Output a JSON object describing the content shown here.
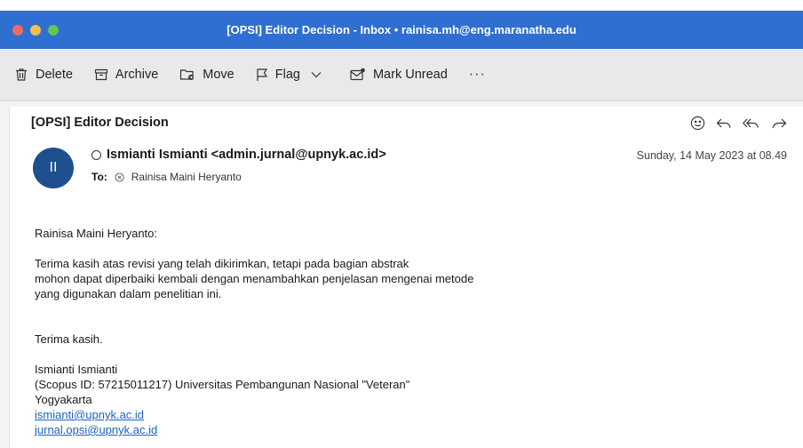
{
  "window": {
    "title": "[OPSI] Editor Decision - Inbox • rainisa.mh@eng.maranatha.edu",
    "traffic_colors": {
      "close": "#ed6a5e",
      "minimize": "#f5bf4f",
      "maximize": "#62c554"
    }
  },
  "toolbar": {
    "delete_label": "Delete",
    "archive_label": "Archive",
    "move_label": "Move",
    "flag_label": "Flag",
    "mark_unread_label": "Mark Unread",
    "more_label": "···"
  },
  "message": {
    "subject": "[OPSI] Editor Decision",
    "avatar_initials": "II",
    "from": "Ismianti Ismianti <admin.jurnal@upnyk.ac.id>",
    "to_label": "To:",
    "to": "Rainisa Maini Heryanto",
    "date": "Sunday, 14 May 2023 at 08.49",
    "body": {
      "salutation": "Rainisa Maini Heryanto:",
      "line1": "Terima kasih atas revisi yang telah dikirimkan, tetapi pada bagian abstrak",
      "line2": "mohon dapat diperbaiki kembali dengan menambahkan penjelasan mengenai metode",
      "line3": "yang digunakan dalam penelitian ini.",
      "closing": "Terima kasih.",
      "sig_name": "Ismianti Ismianti",
      "sig_affil": "(Scopus ID: 57215011217) Universitas Pembangunan Nasional \"Veteran\"",
      "sig_city": "Yogyakarta",
      "sig_email1": "ismianti@upnyk.ac.id",
      "sig_email2": "jurnal.opsi@upnyk.ac.id"
    }
  },
  "colors": {
    "titlebar": "#2f6fd1",
    "avatar": "#1f4f8f",
    "link": "#1a63c7"
  }
}
